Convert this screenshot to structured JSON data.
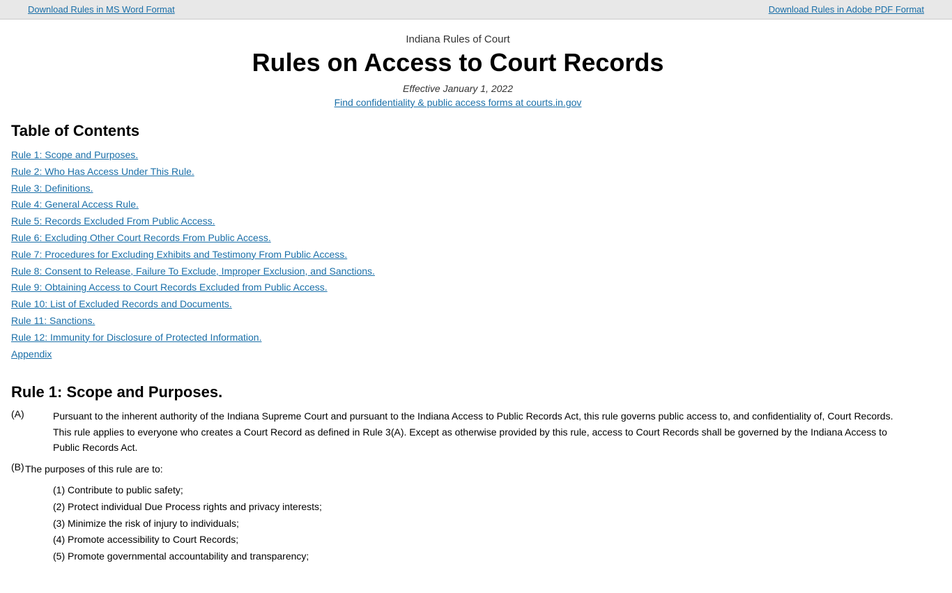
{
  "topbar": {
    "download_word_label": "Download Rules in MS Word Format",
    "download_pdf_label": "Download Rules in Adobe PDF Format"
  },
  "header": {
    "subtitle": "Indiana Rules of Court",
    "main_title": "Rules on Access to Court Records",
    "effective_date": "Effective January 1, 2022",
    "confidentiality_link": "Find confidentiality & public access forms at courts.in.gov"
  },
  "toc": {
    "heading": "Table of Contents",
    "items": [
      {
        "label": "Rule 1: Scope and Purposes.",
        "href": "#rule1"
      },
      {
        "label": "Rule 2: Who Has Access Under This Rule.",
        "href": "#rule2"
      },
      {
        "label": "Rule 3: Definitions.",
        "href": "#rule3"
      },
      {
        "label": "Rule 4: General Access Rule.",
        "href": "#rule4"
      },
      {
        "label": "Rule 5: Records Excluded From Public Access.",
        "href": "#rule5"
      },
      {
        "label": "Rule 6: Excluding Other Court Records From Public Access.",
        "href": "#rule6"
      },
      {
        "label": "Rule 7: Procedures for Excluding Exhibits and Testimony From Public Access.",
        "href": "#rule7"
      },
      {
        "label": "Rule 8: Consent to Release, Failure To Exclude, Improper Exclusion, and Sanctions.",
        "href": "#rule8"
      },
      {
        "label": "Rule 9: Obtaining Access to Court Records Excluded from Public Access.",
        "href": "#rule9"
      },
      {
        "label": "Rule 10: List of Excluded Records and Documents.",
        "href": "#rule10"
      },
      {
        "label": "Rule 11: Sanctions.",
        "href": "#rule11"
      },
      {
        "label": "Rule 12: Immunity for Disclosure of Protected Information.",
        "href": "#rule12"
      },
      {
        "label": "Appendix",
        "href": "#appendix"
      }
    ]
  },
  "rule1": {
    "heading": "Rule 1: Scope and Purposes.",
    "para_a_label": "(A)",
    "para_a_text": "Pursuant to the inherent authority of the Indiana Supreme Court and pursuant to the Indiana Access to Public Records Act, this rule governs public access to, and confidentiality of, Court Records. This rule applies to everyone who creates a Court Record as defined in Rule 3(A). Except as otherwise provided by this rule, access to Court Records shall be governed by the Indiana Access to Public Records Act.",
    "para_b_label": "(B)",
    "para_b_intro": "The purposes of this rule are to:",
    "purposes": [
      "(1) Contribute to public safety;",
      "(2) Protect individual Due Process rights and privacy interests;",
      "(3) Minimize the risk of injury to individuals;",
      "(4) Promote accessibility to Court Records;",
      "(5) Promote governmental accountability and transparency;"
    ]
  }
}
